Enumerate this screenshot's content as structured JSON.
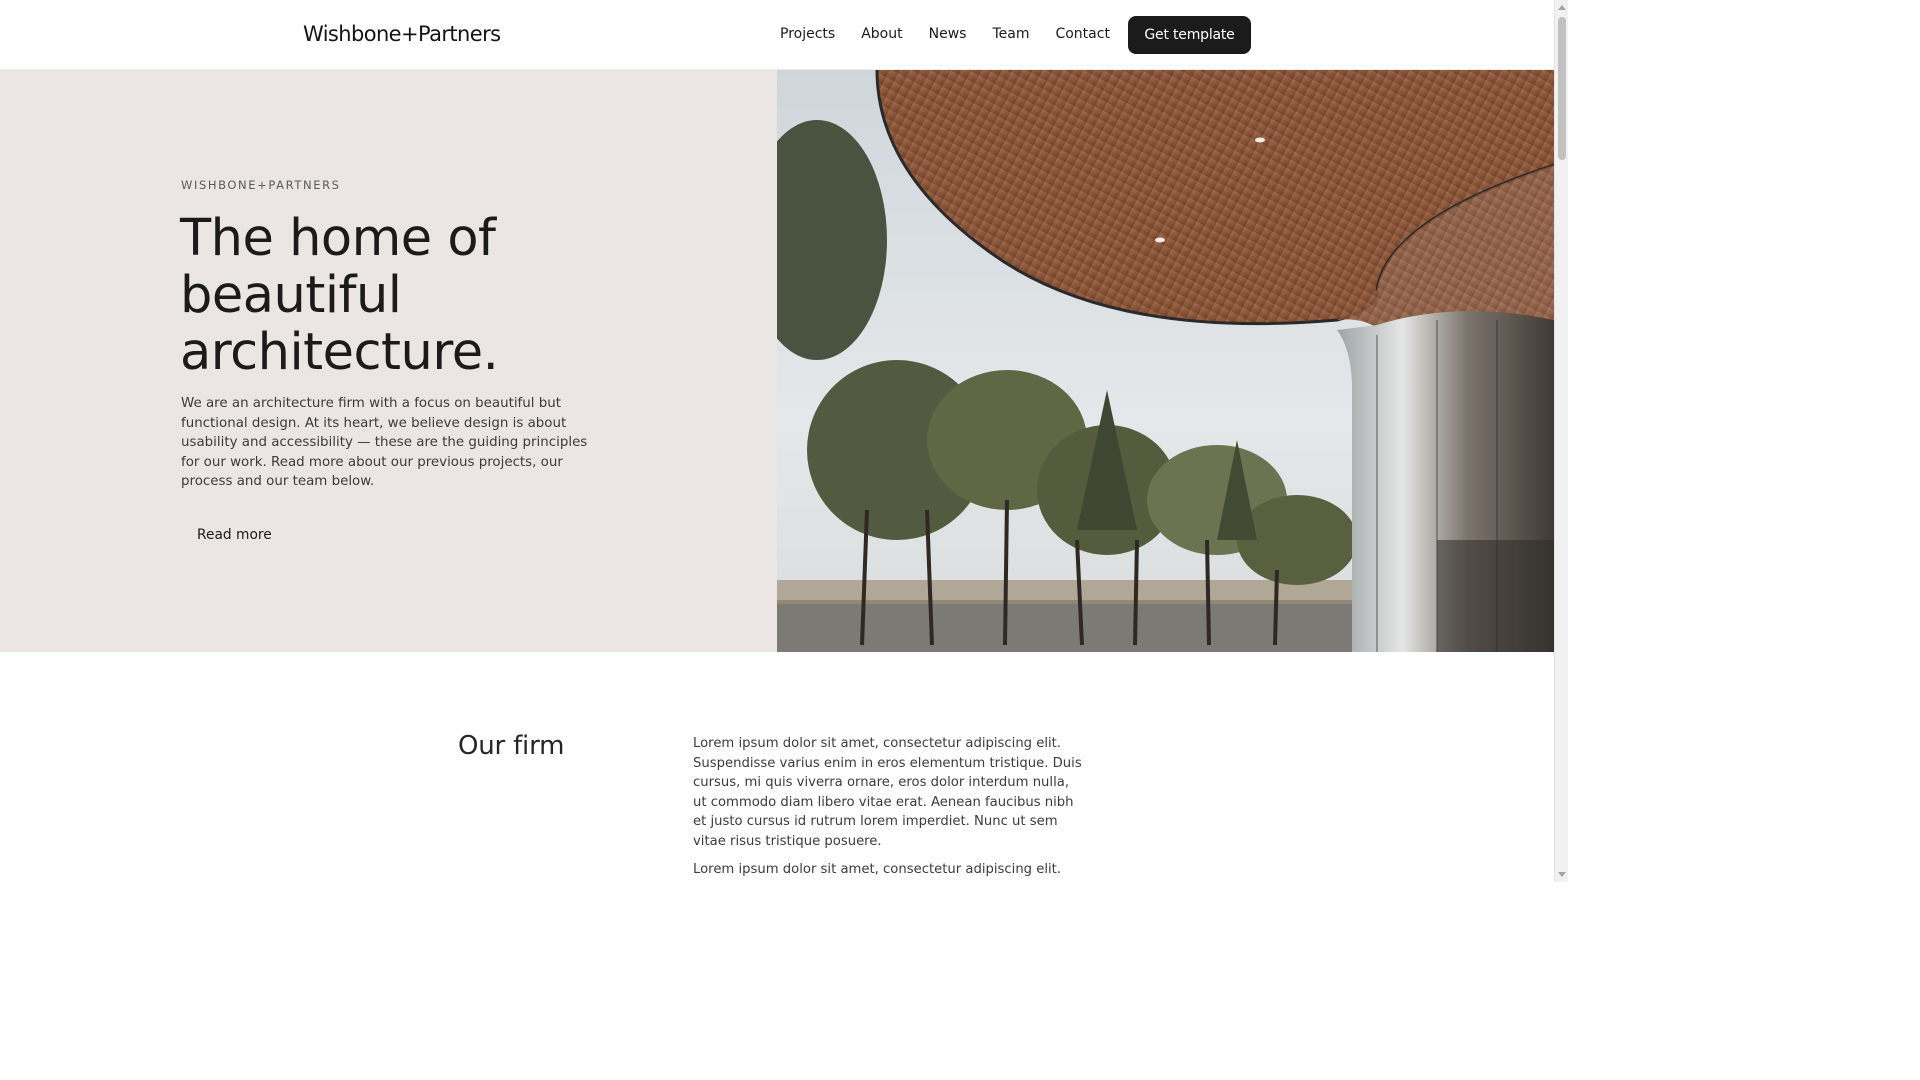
{
  "header": {
    "brand": "Wishbone+Partners",
    "nav": [
      "Projects",
      "About",
      "News",
      "Team",
      "Contact"
    ],
    "cta_label": "Get template"
  },
  "hero": {
    "eyebrow": "WISHBONE+PARTNERS",
    "headline_lines": [
      "The home of",
      "beautiful",
      "architecture."
    ],
    "intro": "We are an architecture firm with a focus on beautiful but functional design. At its heart, we believe design is about usability and accessibility — these are the guiding principles for our work. Read more about our previous projects, our process and our team below.",
    "read_more": "Read more"
  },
  "firm": {
    "title": "Our firm",
    "paragraphs": [
      "Lorem ipsum dolor sit amet, consectetur adipiscing elit. Suspendisse varius enim in eros elementum tristique. Duis cursus, mi quis viverra ornare, eros dolor interdum nulla, ut commodo diam libero vitae erat. Aenean faucibus nibh et justo cursus id rutrum lorem imperdiet. Nunc ut sem vitae risus tristique posuere.",
      "Lorem ipsum dolor sit amet, consectetur adipiscing elit."
    ]
  },
  "colors": {
    "hero_background": "#ebe6e4",
    "cta_background": "#1b1b1b",
    "text": "#1b1b1b"
  }
}
